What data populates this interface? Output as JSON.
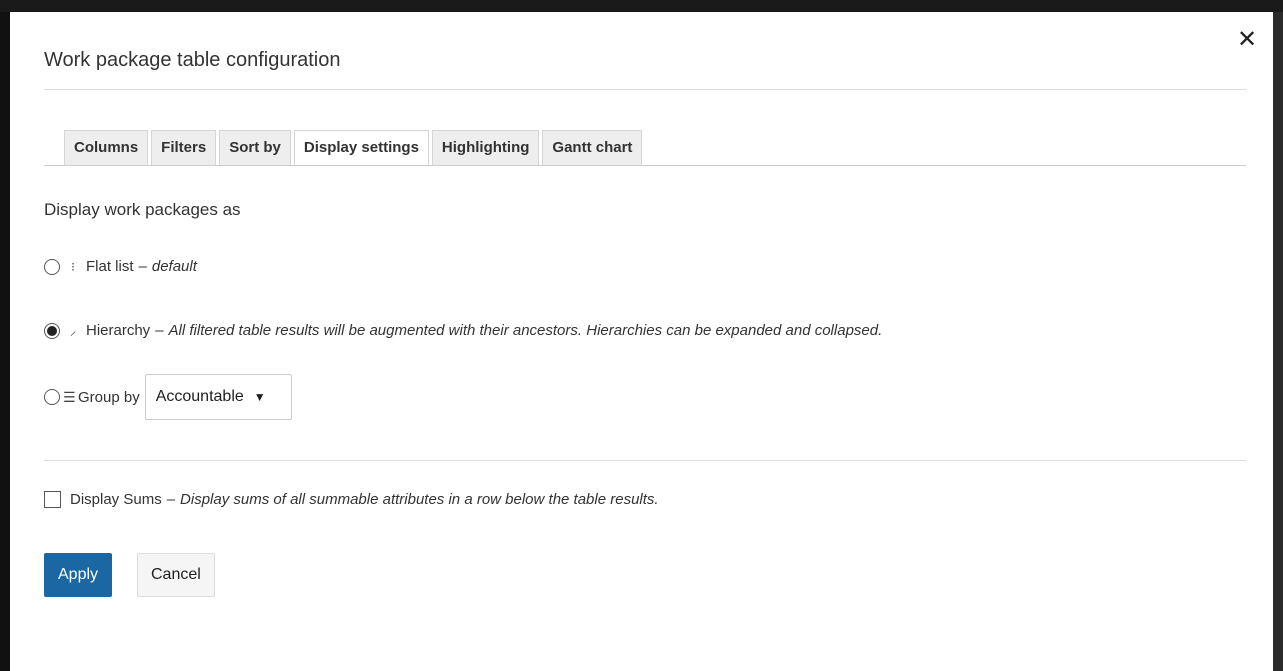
{
  "modal": {
    "title": "Work package table configuration",
    "close_icon": "close-icon",
    "close_glyph": "✕"
  },
  "tabs": [
    {
      "label": "Columns",
      "active": false
    },
    {
      "label": "Filters",
      "active": false
    },
    {
      "label": "Sort by",
      "active": false
    },
    {
      "label": "Display settings",
      "active": true
    },
    {
      "label": "Highlighting",
      "active": false
    },
    {
      "label": "Gantt chart",
      "active": false
    }
  ],
  "display": {
    "section_label": "Display work packages as",
    "options": [
      {
        "key": "flat",
        "selected": false,
        "icon": "flat-list-icon",
        "label": "Flat list",
        "dash": "–",
        "description": "default"
      },
      {
        "key": "hierarchy",
        "selected": true,
        "icon": "hierarchy-icon",
        "label": "Hierarchy",
        "dash": "–",
        "description": "All filtered table results will be augmented with their ancestors. Hierarchies can be expanded and collapsed."
      },
      {
        "key": "group",
        "selected": false,
        "icon": "group-by-icon",
        "label": "Group by",
        "select_value": "Accountable"
      }
    ],
    "sums": {
      "checked": false,
      "label": "Display Sums",
      "dash": "–",
      "description": "Display sums of all summable attributes in a row below the table results."
    }
  },
  "buttons": {
    "apply_label": "Apply",
    "cancel_label": "Cancel"
  },
  "colors": {
    "primary": "#1a67a3",
    "backdrop": "#111111"
  }
}
